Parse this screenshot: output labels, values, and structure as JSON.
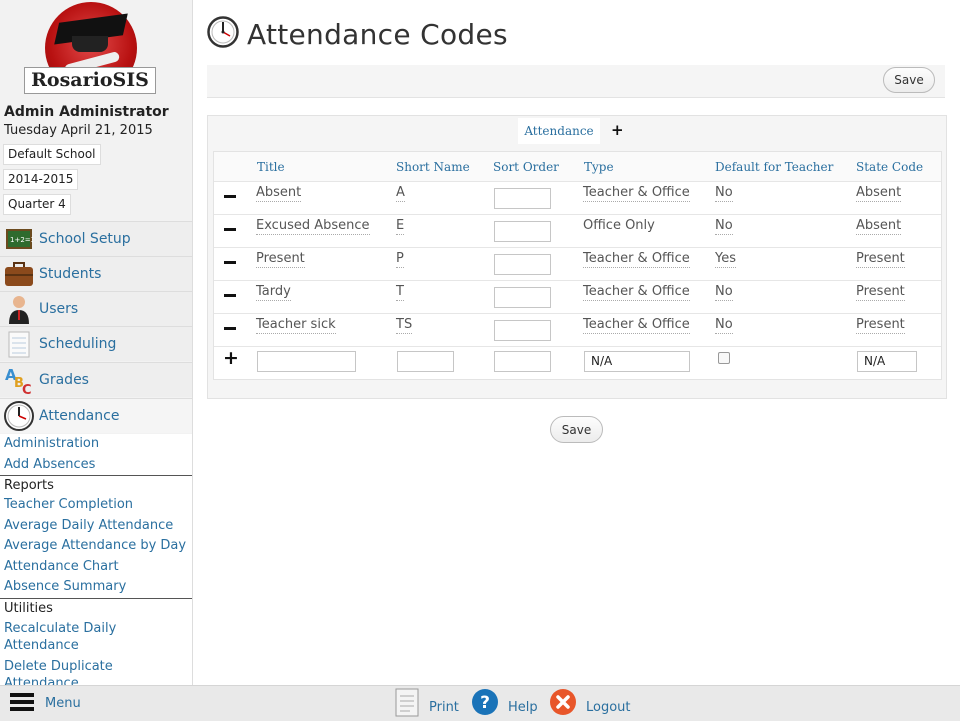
{
  "sidebar": {
    "logo_text": "RosarioSIS",
    "user_name": "Admin Administrator",
    "date": "Tuesday April 21, 2015",
    "school": "Default School",
    "year": "2014-2015",
    "period": "Quarter 4",
    "modules": [
      {
        "label": "School Setup",
        "icon": "chalkboard-icon"
      },
      {
        "label": "Students",
        "icon": "briefcase-icon"
      },
      {
        "label": "Users",
        "icon": "user-icon"
      },
      {
        "label": "Scheduling",
        "icon": "notepad-icon"
      },
      {
        "label": "Grades",
        "icon": "abc-icon"
      },
      {
        "label": "Attendance",
        "icon": "clock-icon"
      }
    ],
    "submenu": {
      "links_top": [
        "Administration",
        "Add Absences"
      ],
      "reports_header": "Reports",
      "reports": [
        "Teacher Completion",
        "Average Daily Attendance",
        "Average Attendance by Day",
        "Attendance Chart",
        "Absence Summary"
      ],
      "utilities_header": "Utilities",
      "utilities": [
        "Recalculate Daily Attendance",
        "Delete Duplicate Attendance"
      ]
    }
  },
  "main": {
    "title": "Attendance Codes",
    "save_label": "Save",
    "tab_label": "Attendance",
    "tab_add": "+",
    "columns": [
      "Title",
      "Short Name",
      "Sort Order",
      "Type",
      "Default for Teacher",
      "State Code"
    ],
    "rows": [
      {
        "title": "Absent",
        "short": "A",
        "type": "Teacher & Office",
        "default": "No",
        "state": "Absent"
      },
      {
        "title": "Excused Absence",
        "short": "E",
        "type": "Office Only",
        "default": "No",
        "state": "Absent"
      },
      {
        "title": "Present",
        "short": "P",
        "type": "Teacher & Office",
        "default": "Yes",
        "state": "Present"
      },
      {
        "title": "Tardy",
        "short": "T",
        "type": "Teacher & Office",
        "default": "No",
        "state": "Present"
      },
      {
        "title": "Teacher sick",
        "short": "TS",
        "type": "Teacher & Office",
        "default": "No",
        "state": "Present"
      }
    ],
    "new_row": {
      "type_value": "N/A",
      "state_value": "N/A"
    }
  },
  "footer": {
    "menu": "Menu",
    "print": "Print",
    "help": "Help",
    "logout": "Logout"
  },
  "colors": {
    "link": "#2a6f9f",
    "logo_red": "#b81111"
  }
}
